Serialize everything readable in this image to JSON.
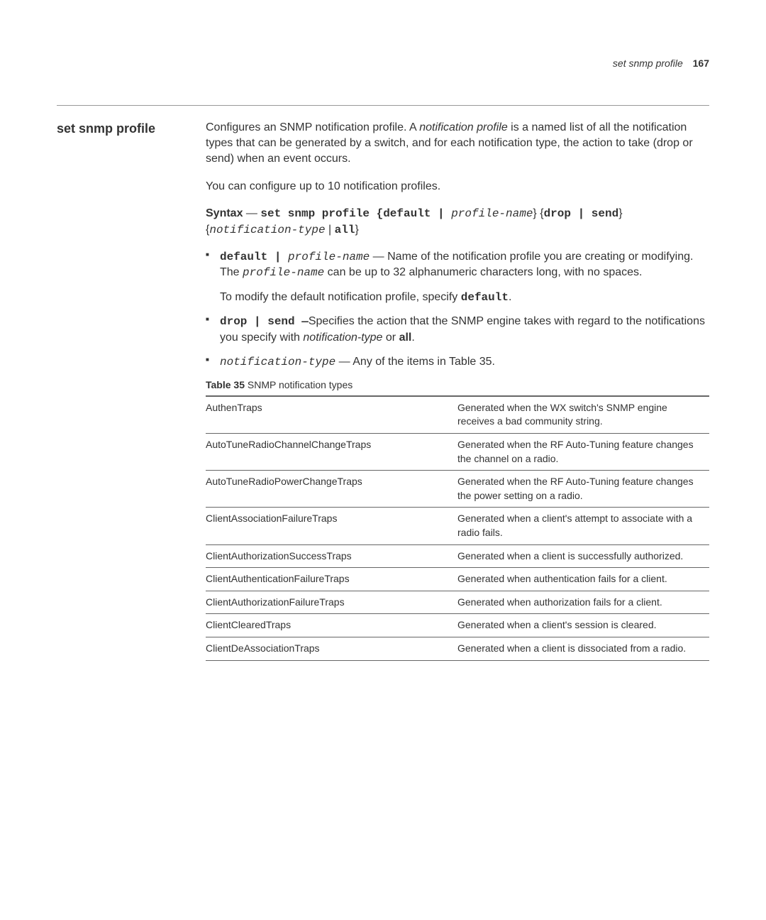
{
  "header": {
    "running_title": "set snmp profile",
    "page_number": "167"
  },
  "section": {
    "title": "set snmp profile",
    "intro_para": "Configures an SNMP notification profile. A ",
    "intro_para_term": "notification profile",
    "intro_para_rest": " is a named list of all the notification types that can be generated by a switch, and for each notification type, the action to take (drop or send) when an event occurs.",
    "config_note": "You can configure up to 10 notification profiles.",
    "syntax_label": "Syntax",
    "syntax_dash": " — ",
    "syntax_cmd": "set snmp profile {default | ",
    "syntax_profile": "profile-name",
    "syntax_mid": "} {",
    "syntax_dropsend": "drop | send",
    "syntax_close1": "} {",
    "syntax_notiftype": "notification-type",
    "syntax_sep": " | ",
    "syntax_all": "all",
    "syntax_close2": "}",
    "bullet1_a": "default | ",
    "bullet1_b": "profile-name",
    "bullet1_c": " — Name of the notification profile you are creating or modifying. The ",
    "bullet1_d": "profile-name",
    "bullet1_e": " can be up to 32 alphanumeric characters long, with no spaces.",
    "bullet1_sub": "To modify the default notification profile, specify ",
    "bullet1_sub_cmd": "default",
    "bullet1_sub_end": ".",
    "bullet2_a": "drop | send —",
    "bullet2_b": "Specifies the action that the SNMP engine takes with regard to the notifications you specify with ",
    "bullet2_c": "notification-type",
    "bullet2_d": " or ",
    "bullet2_e": "all",
    "bullet2_f": ".",
    "bullet3_a": "notification-type",
    "bullet3_b": " — Any of the items in Table 35.",
    "table_caption_bold": "Table 35",
    "table_caption_rest": "   SNMP notification types",
    "table_rows": [
      {
        "name": "AuthenTraps",
        "desc": "Generated when the WX switch's SNMP engine receives a bad community string."
      },
      {
        "name": "AutoTuneRadioChannelChangeTraps",
        "desc": "Generated when the RF Auto-Tuning feature changes the channel on a radio."
      },
      {
        "name": "AutoTuneRadioPowerChangeTraps",
        "desc": "Generated when the RF Auto-Tuning feature changes the power setting on a radio."
      },
      {
        "name": "ClientAssociationFailureTraps",
        "desc": "Generated when a client's attempt to associate with a radio fails."
      },
      {
        "name": "ClientAuthorizationSuccessTraps",
        "desc": "Generated when a client is successfully authorized."
      },
      {
        "name": "ClientAuthenticationFailureTraps",
        "desc": "Generated when authentication fails for a client."
      },
      {
        "name": "ClientAuthorizationFailureTraps",
        "desc": "Generated when authorization fails for a client."
      },
      {
        "name": "ClientClearedTraps",
        "desc": "Generated when a client's session is cleared."
      },
      {
        "name": "ClientDeAssociationTraps",
        "desc": "Generated when a client is dissociated from a radio."
      }
    ]
  }
}
